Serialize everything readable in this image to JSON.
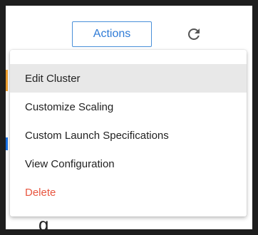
{
  "toolbar": {
    "actions_label": "Actions",
    "refresh_icon": "refresh-icon"
  },
  "menu": {
    "items": [
      {
        "label": "Edit Cluster"
      },
      {
        "label": "Customize Scaling"
      },
      {
        "label": "Custom Launch Specifications"
      },
      {
        "label": "View Configuration"
      },
      {
        "label": "Delete"
      }
    ],
    "highlight_color": "#e8e8e8",
    "danger_color": "#e8553f"
  },
  "accent_color": "#2f7bd6"
}
